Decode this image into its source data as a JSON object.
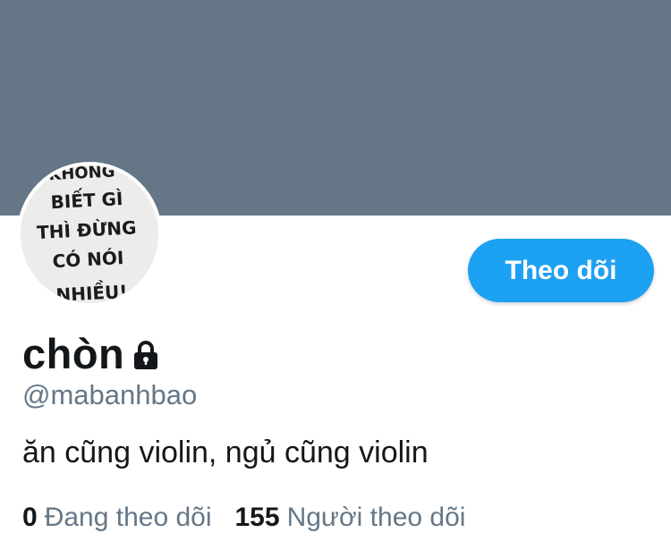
{
  "colors": {
    "banner": "#657786",
    "primary_text": "#14171a",
    "secondary_text": "#657786",
    "accent": "#1da1f2",
    "background": "#ffffff"
  },
  "profile": {
    "display_name": "chòn",
    "handle": "@mabanhbao",
    "bio": "ăn cũng violin, ngủ cũng violin",
    "protected_icon": "lock-icon",
    "avatar": {
      "lines": [
        "KHÔNG",
        "BIẾT GÌ",
        "THÌ ĐỪNG",
        "CÓ NÓI",
        "NHIỀU!"
      ]
    }
  },
  "actions": {
    "follow_label": "Theo dõi"
  },
  "stats": {
    "following_count": "0",
    "following_label": "Đang theo dõi",
    "followers_count": "155",
    "followers_label": "Người theo dõi"
  }
}
